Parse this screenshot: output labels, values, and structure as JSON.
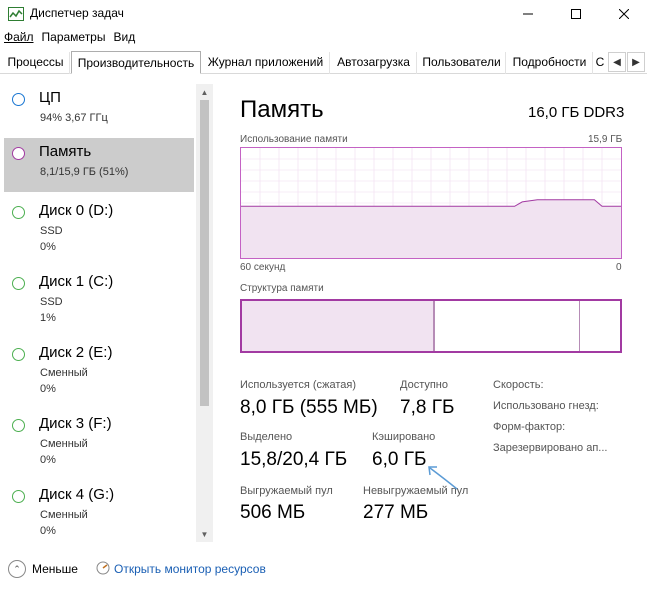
{
  "window": {
    "title": "Диспетчер задач",
    "controls": [
      "minimize",
      "maximize",
      "close"
    ]
  },
  "menu": [
    {
      "label": "Файл",
      "accel": "Ф"
    },
    {
      "label": "Параметры",
      "accel": "П"
    },
    {
      "label": "Вид",
      "accel": "В"
    }
  ],
  "tabs": [
    {
      "label": "Процессы",
      "active": false
    },
    {
      "label": "Производительность",
      "active": true
    },
    {
      "label": "Журнал приложений",
      "active": false
    },
    {
      "label": "Автозагрузка",
      "active": false
    },
    {
      "label": "Пользователи",
      "active": false
    },
    {
      "label": "Подробности",
      "active": false
    },
    {
      "label": "С",
      "active": false
    }
  ],
  "sidebar": {
    "items": [
      {
        "title": "ЦП",
        "sub1": "94%  3,67 ГГц",
        "sub2": "",
        "color": "#1976d2",
        "selected": false
      },
      {
        "title": "Память",
        "sub1": "8,1/15,9 ГБ (51%)",
        "sub2": "",
        "color": "#a23aa2",
        "selected": true
      },
      {
        "title": "Диск 0 (D:)",
        "sub1": "SSD",
        "sub2": "0%",
        "color": "#4caf50",
        "selected": false
      },
      {
        "title": "Диск 1 (C:)",
        "sub1": "SSD",
        "sub2": "1%",
        "color": "#4caf50",
        "selected": false
      },
      {
        "title": "Диск 2 (E:)",
        "sub1": "Сменный",
        "sub2": "0%",
        "color": "#4caf50",
        "selected": false
      },
      {
        "title": "Диск 3 (F:)",
        "sub1": "Сменный",
        "sub2": "0%",
        "color": "#4caf50",
        "selected": false
      },
      {
        "title": "Диск 4 (G:)",
        "sub1": "Сменный",
        "sub2": "0%",
        "color": "#4caf50",
        "selected": false
      }
    ]
  },
  "main": {
    "title": "Память",
    "spec": "16,0 ГБ DDR3",
    "usage_label": "Использование памяти",
    "usage_max": "15,9 ГБ",
    "time_left": "60 секунд",
    "time_right": "0",
    "usage_fraction_start": 0.47,
    "usage_fraction_end": 0.52,
    "structure_label": "Структура памяти",
    "structure_in_use_fraction": 0.51,
    "structure_standby_fraction": 0.38,
    "stats": {
      "in_use_label": "Используется (сжатая)",
      "in_use_value": "8,0 ГБ (555 МБ)",
      "available_label": "Доступно",
      "available_value": "7,8 ГБ",
      "committed_label": "Выделено",
      "committed_value": "15,8/20,4 ГБ",
      "cached_label": "Кэшировано",
      "cached_value": "6,0 ГБ",
      "paged_label": "Выгружаемый пул",
      "paged_value": "506 МБ",
      "nonpaged_label": "Невыгружаемый пул",
      "nonpaged_value": "277 МБ"
    },
    "right_labels": [
      "Скорость:",
      "Использовано гнезд:",
      "Форм-фактор:",
      "Зарезервировано ап..."
    ]
  },
  "footer": {
    "less_label": "Меньше",
    "monitor_link": "Открыть монитор ресурсов"
  },
  "colors": {
    "memory_accent": "#a23aa2",
    "memory_fill": "#f1e3f1",
    "link": "#1a5fb4",
    "selected_bg": "#cccccc"
  }
}
